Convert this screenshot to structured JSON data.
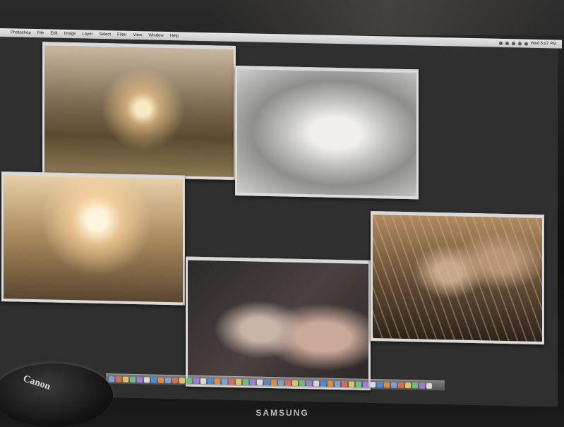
{
  "menubar": {
    "apple": "",
    "items": [
      "Photoshop",
      "File",
      "Edit",
      "Image",
      "Layer",
      "Select",
      "Filter",
      "View",
      "Window",
      "Help"
    ],
    "clock": "Wed 5:07 PM"
  },
  "photos": [
    {
      "name": "photo-couple-sunset-1"
    },
    {
      "name": "photo-girl-bw"
    },
    {
      "name": "photo-couple-sunset-2"
    },
    {
      "name": "photo-couple-closeup"
    },
    {
      "name": "photo-couple-grass"
    }
  ],
  "monitor": {
    "brand": "SAMSUNG"
  },
  "lens_cap": {
    "brand": "Canon"
  }
}
